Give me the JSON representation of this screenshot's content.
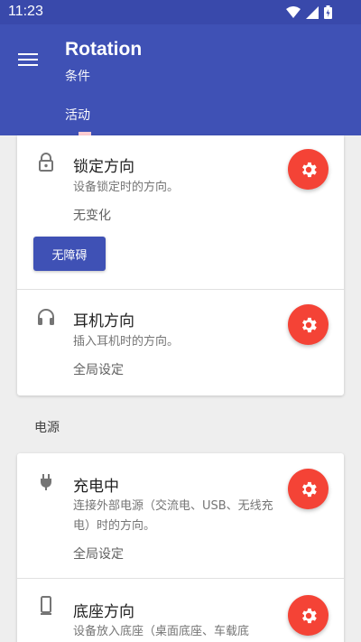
{
  "status_bar": {
    "time": "11:23",
    "icons": [
      "wifi-icon",
      "signal-icon",
      "battery-icon"
    ]
  },
  "app_bar": {
    "title": "Rotation",
    "subtitle": "条件",
    "tab": "活动",
    "colors": {
      "primary": "#3f51b5",
      "status": "#3949ab",
      "accent": "#f44336"
    }
  },
  "card1": {
    "lock": {
      "title": "锁定方向",
      "desc": "设备锁定时的方向。",
      "value": "无变化",
      "button": "无障碍",
      "icon": "lock-icon"
    },
    "headset": {
      "title": "耳机方向",
      "desc": "插入耳机时的方向。",
      "value": "全局设定",
      "icon": "headset-icon"
    }
  },
  "section": {
    "power": "电源"
  },
  "card2": {
    "charging": {
      "title": "充电中",
      "desc": "连接外部电源（交流电、USB、无线充电）时的方向。",
      "value": "全局设定",
      "icon": "plug-icon"
    },
    "dock": {
      "title": "底座方向",
      "desc": "设备放入底座（桌面底座、车载底",
      "icon": "phone-dock-icon"
    }
  }
}
